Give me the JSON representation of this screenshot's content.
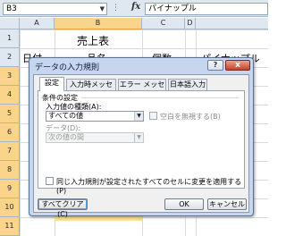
{
  "formula_bar": {
    "name_box": "B3",
    "dots": "⋮",
    "fx_label": "fx",
    "content": "パイナップル"
  },
  "sheet": {
    "columns": [
      "A",
      "B",
      "C",
      "D"
    ],
    "rows": [
      "1",
      "2",
      "3",
      "4",
      "5",
      "6",
      "7",
      "8",
      "9",
      "10",
      "11",
      "12"
    ],
    "cells": {
      "b1": "売上表",
      "a2": "日付",
      "b2": "品名",
      "c2": "個数",
      "d2": "パイナップル"
    },
    "colors": {
      "selection": "#fbe39a",
      "header_selected": "#f9d48a"
    }
  },
  "dialog": {
    "title": "データの入力規則",
    "help_label": "?",
    "close_label": "x",
    "tabs": [
      "設定",
      "入力時メッセージ",
      "エラー メッセージ",
      "日本語入力"
    ],
    "group_label": "条件の設定",
    "allow_label": "入力値の種類(A):",
    "allow_value": "すべての値",
    "ignore_blank_label": "空白を無視する(B)",
    "data_label": "データ(D):",
    "data_value": "次の値の間",
    "apply_all_label": "同じ入力規則が設定されたすべてのセルに変更を適用する(P)",
    "clear_all_button": "すべてクリア(C)",
    "ok_button": "OK",
    "cancel_button": "キャンセル",
    "colors": {
      "frame": "#c5d6ee",
      "close": "#c2432a"
    }
  }
}
